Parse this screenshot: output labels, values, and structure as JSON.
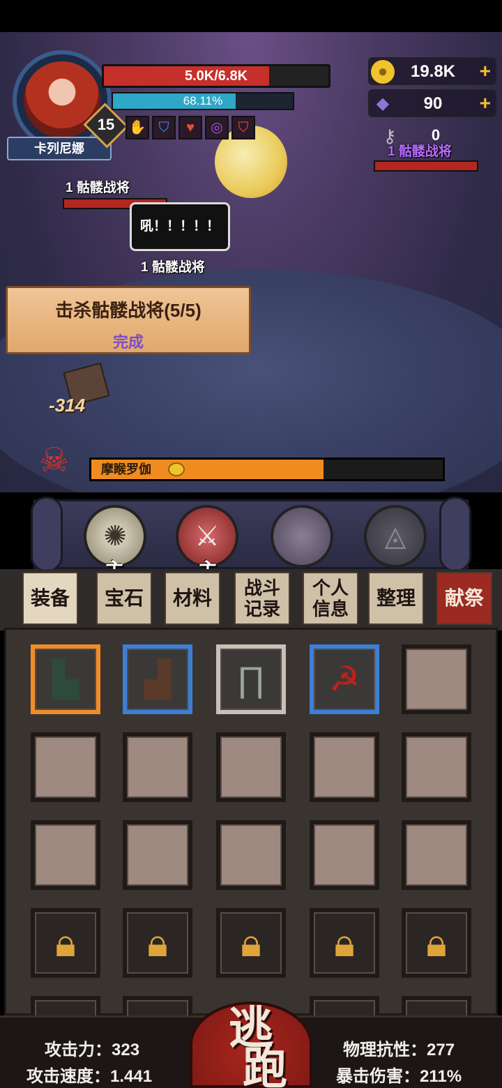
{
  "player": {
    "name": "卡列尼娜",
    "level": "15",
    "hp_text": "5.0K/6.8K",
    "hp_fraction": 0.735,
    "xp_text": "68.11%",
    "xp_fraction": 0.6811
  },
  "currency": {
    "gold": "19.8K",
    "gems": "90",
    "keys": "0"
  },
  "buffs": [
    "hand-up-icon",
    "shield-down-icon",
    "heart-up-icon",
    "vortex-up-icon",
    "shield-up-icon"
  ],
  "enemies": {
    "left_top": "1 骷髅战将",
    "left_mid": "1 骷髅战将",
    "right_top": "1 骷髅战将"
  },
  "speech": "吼！！！！！",
  "quest": {
    "title": "击杀骷髅战将(5/5)",
    "status": "完成"
  },
  "damage_text": "-314",
  "boss": {
    "name": "摩睺罗伽",
    "hp_fraction": 0.66
  },
  "skills": {
    "tag_1": "主",
    "tag_2": "主"
  },
  "tabs": {
    "equipment": "装备",
    "gems": "宝石",
    "materials": "材料",
    "battle_log_1": "战斗",
    "battle_log_2": "记录",
    "info_1": "个人",
    "info_2": "信息",
    "sort": "整理",
    "sacrifice": "献祭"
  },
  "stats": {
    "attack": "攻击力：323",
    "attack_speed": "攻击速度：1.441",
    "phys_res": "物理抗性：277",
    "crit_dmg": "暴击伤害：211%"
  },
  "flee_1": "逃",
  "flee_2": "跑",
  "colors": {
    "hp": "#c6302a",
    "xp": "#2fa7c6",
    "boss": "#f08b1f",
    "rarity_orange": "#f28c28",
    "rarity_blue": "#3b7fd6",
    "rarity_grey": "#c6c0b8"
  }
}
